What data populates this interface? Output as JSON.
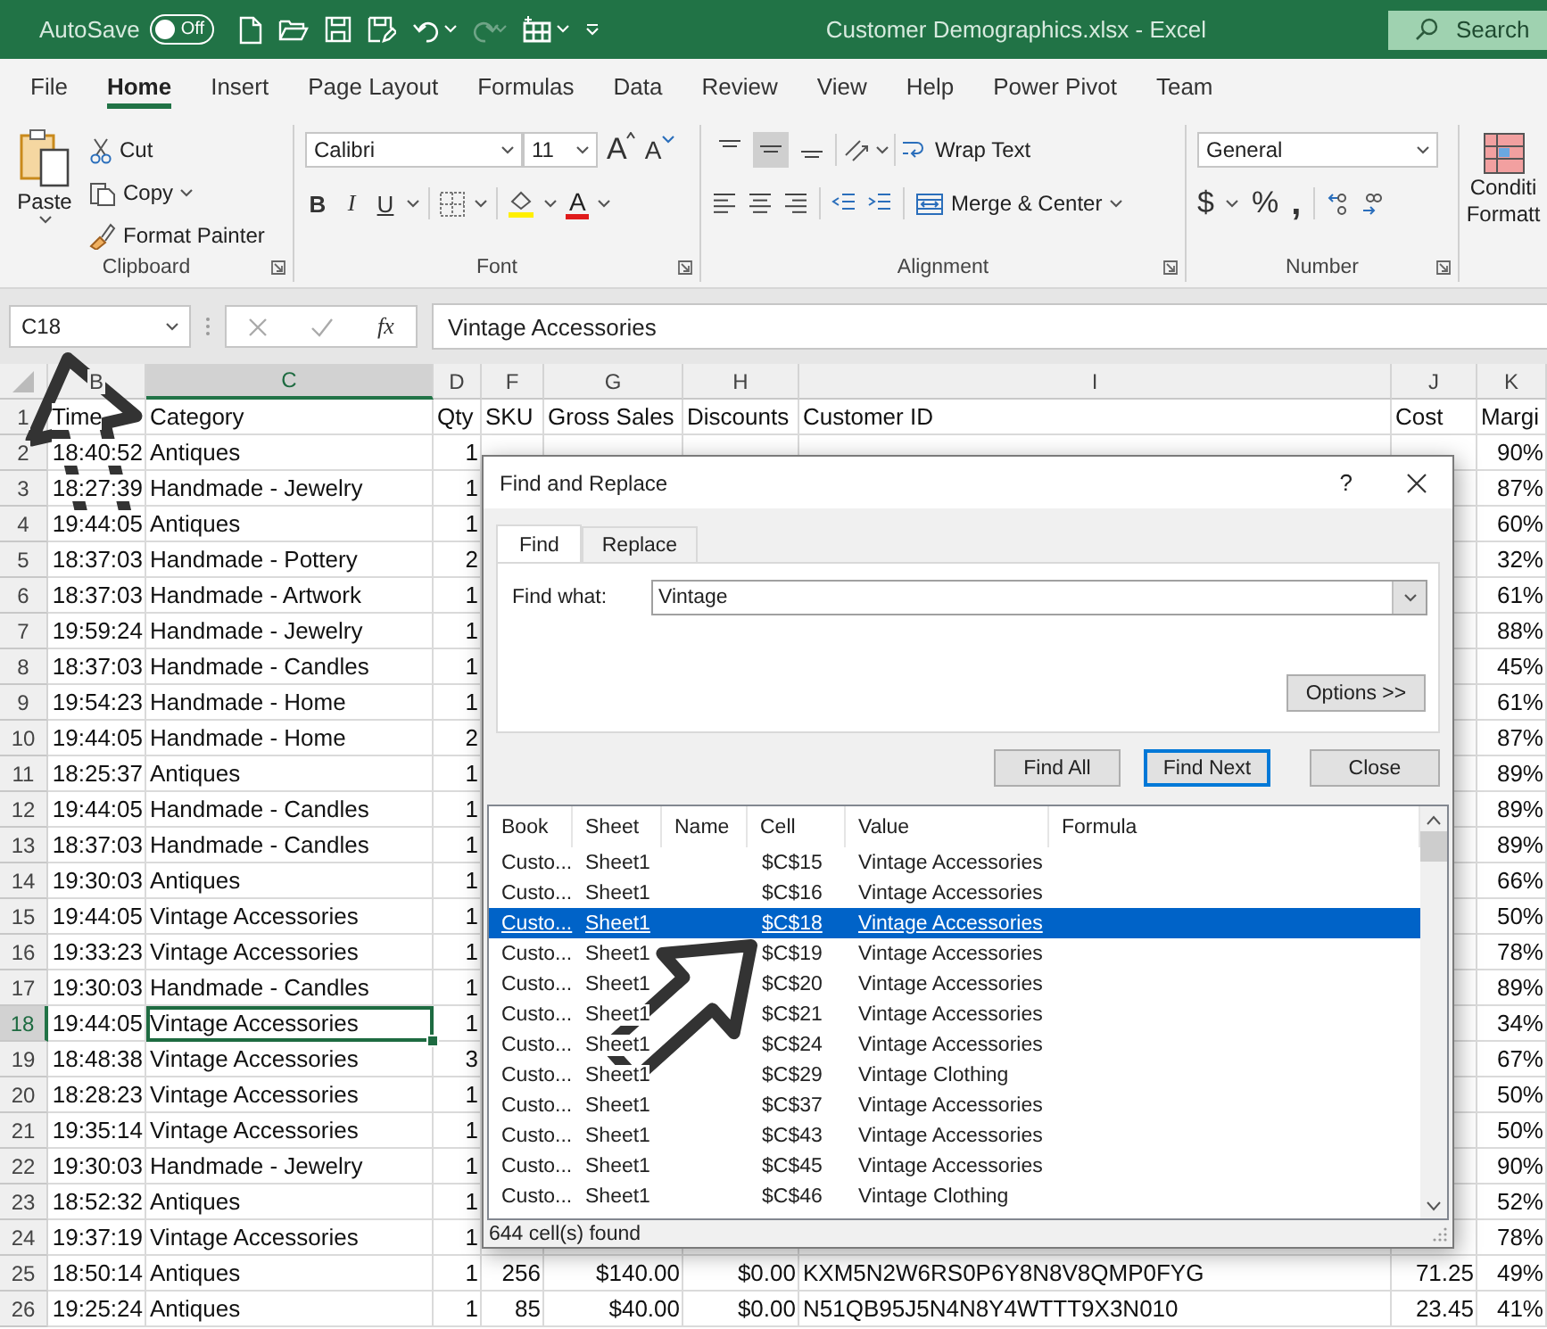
{
  "title_bar": {
    "autosave_label": "AutoSave",
    "autosave_toggle": {
      "label": "Off",
      "on": false
    },
    "redo_disabled": true,
    "title": "Customer Demographics.xlsx  -  Excel",
    "search_placeholder": "Search"
  },
  "menu_tabs": [
    {
      "label": "File",
      "selected": false
    },
    {
      "label": "Home",
      "selected": true
    },
    {
      "label": "Insert",
      "selected": false
    },
    {
      "label": "Page Layout",
      "selected": false
    },
    {
      "label": "Formulas",
      "selected": false
    },
    {
      "label": "Data",
      "selected": false
    },
    {
      "label": "Review",
      "selected": false
    },
    {
      "label": "View",
      "selected": false
    },
    {
      "label": "Help",
      "selected": false
    },
    {
      "label": "Power Pivot",
      "selected": false
    },
    {
      "label": "Team",
      "selected": false
    }
  ],
  "ribbon": {
    "clipboard": {
      "paste": "Paste",
      "cut": "Cut",
      "copy": "Copy",
      "format_painter": "Format Painter",
      "label": "Clipboard"
    },
    "font": {
      "font_name": "Calibri",
      "font_size": "11",
      "grow": "A",
      "shrink": "A",
      "bold": "B",
      "italic": "I",
      "underline": "U",
      "font_color": "A",
      "label": "Font"
    },
    "alignment": {
      "vertical_align": [
        {
          "selected": false
        },
        {
          "selected": true
        },
        {
          "selected": false
        }
      ],
      "wrap_text": "Wrap Text",
      "merge_center": "Merge & Center",
      "label": "Alignment"
    },
    "number": {
      "format": "General",
      "currency": "$",
      "percent": "%",
      "comma": ",",
      "label": "Number"
    },
    "conditional_formatting": {
      "line_1": "Conditi",
      "line_2": "Formatt"
    }
  },
  "formula_bar": {
    "name_box": "C18",
    "function_label": "fx",
    "formula": "Vintage Accessories"
  },
  "sheet": {
    "columns": [
      {
        "label": "B",
        "kind": "number",
        "selected": false
      },
      {
        "label": "C",
        "kind": "text",
        "selected": true
      },
      {
        "label": "D",
        "kind": "number",
        "selected": false
      },
      {
        "label": "F",
        "kind": "number",
        "selected": false
      },
      {
        "label": "G",
        "kind": "number",
        "selected": false
      },
      {
        "label": "H",
        "kind": "number",
        "selected": false
      },
      {
        "label": "I",
        "kind": "text",
        "selected": false
      },
      {
        "label": "J",
        "kind": "number",
        "selected": false
      },
      {
        "label": "K",
        "kind": "number",
        "selected": false
      }
    ],
    "rows": [
      {
        "number": "1",
        "kind": "header",
        "selected": false,
        "cells": [
          "Time",
          "Category",
          "Qty",
          "SKU",
          "Gross Sales",
          "Discounts",
          "Customer ID",
          "Cost",
          "Margi"
        ]
      },
      {
        "number": "2",
        "kind": "data",
        "selected": false,
        "cells": [
          "18:40:52",
          "Antiques",
          "1",
          null,
          null,
          null,
          null,
          null,
          "90%"
        ]
      },
      {
        "number": "3",
        "kind": "data",
        "selected": false,
        "cells": [
          "18:27:39",
          "Handmade - Jewelry",
          "1",
          null,
          null,
          null,
          null,
          null,
          "87%"
        ]
      },
      {
        "number": "4",
        "kind": "data",
        "selected": false,
        "cells": [
          "19:44:05",
          "Antiques",
          "1",
          null,
          null,
          null,
          null,
          null,
          "60%"
        ]
      },
      {
        "number": "5",
        "kind": "data",
        "selected": false,
        "cells": [
          "18:37:03",
          "Handmade - Pottery",
          "2",
          null,
          null,
          null,
          null,
          null,
          "32%"
        ]
      },
      {
        "number": "6",
        "kind": "data",
        "selected": false,
        "cells": [
          "18:37:03",
          "Handmade - Artwork",
          "1",
          null,
          null,
          null,
          null,
          null,
          "61%"
        ]
      },
      {
        "number": "7",
        "kind": "data",
        "selected": false,
        "cells": [
          "19:59:24",
          "Handmade - Jewelry",
          "1",
          null,
          null,
          null,
          null,
          null,
          "88%"
        ]
      },
      {
        "number": "8",
        "kind": "data",
        "selected": false,
        "cells": [
          "18:37:03",
          "Handmade - Candles",
          "1",
          null,
          null,
          null,
          null,
          null,
          "45%"
        ]
      },
      {
        "number": "9",
        "kind": "data",
        "selected": false,
        "cells": [
          "19:54:23",
          "Handmade - Home",
          "1",
          null,
          null,
          null,
          null,
          null,
          "61%"
        ]
      },
      {
        "number": "10",
        "kind": "data",
        "selected": false,
        "cells": [
          "19:44:05",
          "Handmade - Home",
          "2",
          null,
          null,
          null,
          null,
          null,
          "87%"
        ]
      },
      {
        "number": "11",
        "kind": "data",
        "selected": false,
        "cells": [
          "18:25:37",
          "Antiques",
          "1",
          null,
          null,
          null,
          null,
          null,
          "89%"
        ]
      },
      {
        "number": "12",
        "kind": "data",
        "selected": false,
        "cells": [
          "19:44:05",
          "Handmade - Candles",
          "1",
          null,
          null,
          null,
          null,
          null,
          "89%"
        ]
      },
      {
        "number": "13",
        "kind": "data",
        "selected": false,
        "cells": [
          "18:37:03",
          "Handmade - Candles",
          "1",
          null,
          null,
          null,
          null,
          null,
          "89%"
        ]
      },
      {
        "number": "14",
        "kind": "data",
        "selected": false,
        "cells": [
          "19:30:03",
          "Antiques",
          "1",
          null,
          null,
          null,
          null,
          null,
          "66%"
        ]
      },
      {
        "number": "15",
        "kind": "data",
        "selected": false,
        "cells": [
          "19:44:05",
          "Vintage Accessories",
          "1",
          null,
          null,
          null,
          null,
          null,
          "50%"
        ]
      },
      {
        "number": "16",
        "kind": "data",
        "selected": false,
        "cells": [
          "19:33:23",
          "Vintage Accessories",
          "1",
          null,
          null,
          null,
          null,
          null,
          "78%"
        ]
      },
      {
        "number": "17",
        "kind": "data",
        "selected": false,
        "cells": [
          "19:30:03",
          "Handmade - Candles",
          "1",
          null,
          null,
          null,
          null,
          null,
          "89%"
        ]
      },
      {
        "number": "18",
        "kind": "data",
        "selected": true,
        "cells": [
          "19:44:05",
          "Vintage Accessories",
          "1",
          null,
          null,
          null,
          null,
          null,
          "34%"
        ]
      },
      {
        "number": "19",
        "kind": "data",
        "selected": false,
        "cells": [
          "18:48:38",
          "Vintage Accessories",
          "3",
          null,
          null,
          null,
          null,
          null,
          "67%"
        ]
      },
      {
        "number": "20",
        "kind": "data",
        "selected": false,
        "cells": [
          "18:28:23",
          "Vintage Accessories",
          "1",
          null,
          null,
          null,
          null,
          null,
          "50%"
        ]
      },
      {
        "number": "21",
        "kind": "data",
        "selected": false,
        "cells": [
          "19:35:14",
          "Vintage Accessories",
          "1",
          null,
          null,
          null,
          null,
          null,
          "50%"
        ]
      },
      {
        "number": "22",
        "kind": "data",
        "selected": false,
        "cells": [
          "19:30:03",
          "Handmade - Jewelry",
          "1",
          null,
          null,
          null,
          null,
          null,
          "90%"
        ]
      },
      {
        "number": "23",
        "kind": "data",
        "selected": false,
        "cells": [
          "18:52:32",
          "Antiques",
          "1",
          null,
          null,
          null,
          null,
          null,
          "52%"
        ]
      },
      {
        "number": "24",
        "kind": "data",
        "selected": false,
        "cells": [
          "19:37:19",
          "Vintage Accessories",
          "1",
          null,
          null,
          null,
          null,
          null,
          "78%"
        ]
      },
      {
        "number": "25",
        "kind": "data",
        "selected": false,
        "cells": [
          "18:50:14",
          "Antiques",
          "1",
          "256",
          "$140.00",
          "$0.00",
          "KXM5N2W6RS0P6Y8N8V8QMP0FYG",
          "71.25",
          "49%"
        ]
      },
      {
        "number": "26",
        "kind": "data",
        "selected": false,
        "cells": [
          "19:25:24",
          "Antiques",
          "1",
          "85",
          "$40.00",
          "$0.00",
          "N51QB95J5N4N8Y4WTTT9X3N010",
          "23.45",
          "41%"
        ]
      }
    ]
  },
  "find_replace_dialog": {
    "title": "Find and Replace",
    "help": "?",
    "tabs": [
      {
        "label": "Find",
        "selected": true
      },
      {
        "label": "Replace",
        "selected": false
      }
    ],
    "find_what_label": "Find what:",
    "find_what_value": "Vintage",
    "options_button": "Options >>",
    "buttons": [
      {
        "label": "Find All",
        "focused": false
      },
      {
        "label": "Find Next",
        "focused": true
      },
      {
        "label": "Close",
        "focused": false
      }
    ],
    "results": {
      "columns": [
        "Book",
        "Sheet",
        "Name",
        "Cell",
        "Value",
        "Formula"
      ],
      "rows": [
        {
          "book": "Custo...",
          "sheet": "Sheet1",
          "cell": "$C$15",
          "value": "Vintage Accessories",
          "selected": false
        },
        {
          "book": "Custo...",
          "sheet": "Sheet1",
          "cell": "$C$16",
          "value": "Vintage Accessories",
          "selected": false
        },
        {
          "book": "Custo...",
          "sheet": "Sheet1",
          "cell": "$C$18",
          "value": "Vintage Accessories",
          "selected": true
        },
        {
          "book": "Custo...",
          "sheet": "Sheet1",
          "cell": "$C$19",
          "value": "Vintage Accessories",
          "selected": false
        },
        {
          "book": "Custo...",
          "sheet": "Sheet1",
          "cell": "$C$20",
          "value": "Vintage Accessories",
          "selected": false
        },
        {
          "book": "Custo...",
          "sheet": "Sheet1",
          "cell": "$C$21",
          "value": "Vintage Accessories",
          "selected": false
        },
        {
          "book": "Custo...",
          "sheet": "Sheet1",
          "cell": "$C$24",
          "value": "Vintage Accessories",
          "selected": false
        },
        {
          "book": "Custo...",
          "sheet": "Sheet1",
          "cell": "$C$29",
          "value": "Vintage Clothing",
          "selected": false
        },
        {
          "book": "Custo...",
          "sheet": "Sheet1",
          "cell": "$C$37",
          "value": "Vintage Accessories",
          "selected": false
        },
        {
          "book": "Custo...",
          "sheet": "Sheet1",
          "cell": "$C$43",
          "value": "Vintage Accessories",
          "selected": false
        },
        {
          "book": "Custo...",
          "sheet": "Sheet1",
          "cell": "$C$45",
          "value": "Vintage Accessories",
          "selected": false
        },
        {
          "book": "Custo...",
          "sheet": "Sheet1",
          "cell": "$C$46",
          "value": "Vintage Clothing",
          "selected": false
        }
      ]
    },
    "status": "644 cell(s) found"
  }
}
